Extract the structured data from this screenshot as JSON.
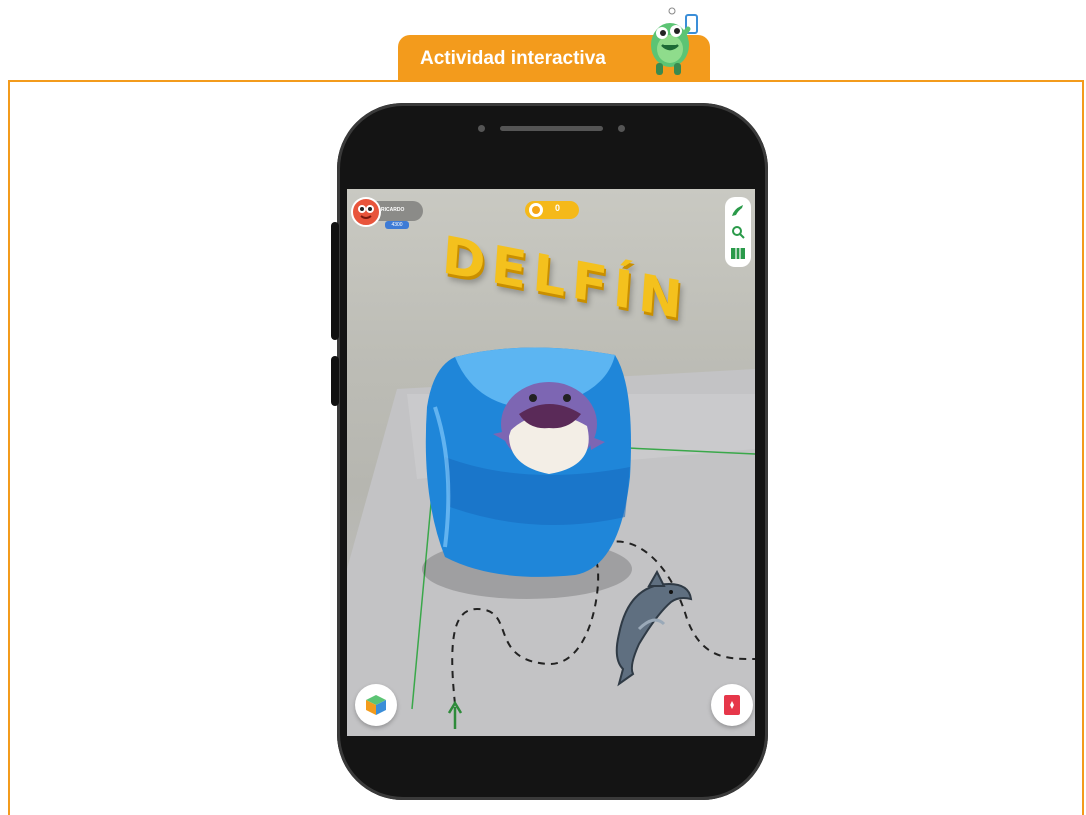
{
  "header": {
    "title": "Actividad interactiva",
    "accent_color": "#f39b1c",
    "mascot_icon": "green-monster-with-phone-icon"
  },
  "app": {
    "user": {
      "name": "RICARDO",
      "score": "4300",
      "avatar_icon": "red-monster-avatar-icon"
    },
    "coins": {
      "count": "0",
      "icon": "coin-icon"
    },
    "toolbar": {
      "icons": [
        "dolphin-silhouette-icon",
        "search-icon",
        "map-icon"
      ]
    },
    "scene": {
      "word": "DELFÍN",
      "object": "blue-cube-with-dolphin",
      "path": "dashed-path"
    },
    "buttons": {
      "left_icon": "blocks-icon",
      "right_icon": "card-icon"
    }
  }
}
